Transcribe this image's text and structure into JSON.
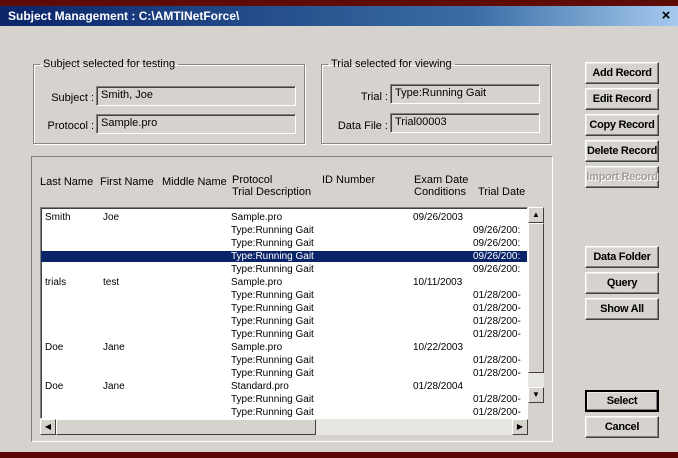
{
  "window": {
    "title": "Subject Management : C:\\AMTINetForce\\",
    "close_glyph": "×"
  },
  "subject_group": {
    "legend": "Subject selected for testing",
    "subject_label": "Subject :",
    "subject_value": "Smith, Joe",
    "protocol_label": "Protocol :",
    "protocol_value": "Sample.pro"
  },
  "trial_group": {
    "legend": "Trial selected for viewing",
    "trial_label": "Trial :",
    "trial_value": "Type:Running Gait",
    "datafile_label": "Data File :",
    "datafile_value": "Trial00003"
  },
  "list": {
    "headers": {
      "last_name": "Last Name",
      "first_name": "First Name",
      "middle_name": "Middle Name",
      "protocol": "Protocol",
      "trial_description": "Trial Description",
      "id_number": "ID Number",
      "exam_date": "Exam Date",
      "conditions": "Conditions",
      "trial_date": "Trial Date"
    },
    "rows": [
      {
        "last": "Smith",
        "first": "Joe",
        "desc": "Sample.pro",
        "exam": "09/26/2003",
        "trial": "",
        "selected": false
      },
      {
        "last": "",
        "first": "",
        "desc": "Type:Running Gait",
        "exam": "",
        "trial": "09/26/200:",
        "selected": false
      },
      {
        "last": "",
        "first": "",
        "desc": "Type:Running Gait",
        "exam": "",
        "trial": "09/26/200:",
        "selected": false
      },
      {
        "last": "",
        "first": "",
        "desc": "Type:Running Gait",
        "exam": "",
        "trial": "09/26/200:",
        "selected": true
      },
      {
        "last": "",
        "first": "",
        "desc": "Type:Running Gait",
        "exam": "",
        "trial": "09/26/200:",
        "selected": false
      },
      {
        "last": "trials",
        "first": "test",
        "desc": "Sample.pro",
        "exam": "10/11/2003",
        "trial": "",
        "selected": false
      },
      {
        "last": "",
        "first": "",
        "desc": "Type:Running Gait",
        "exam": "",
        "trial": "01/28/200-",
        "selected": false
      },
      {
        "last": "",
        "first": "",
        "desc": "Type:Running Gait",
        "exam": "",
        "trial": "01/28/200-",
        "selected": false
      },
      {
        "last": "",
        "first": "",
        "desc": "Type:Running Gait",
        "exam": "",
        "trial": "01/28/200-",
        "selected": false
      },
      {
        "last": "",
        "first": "",
        "desc": "Type:Running Gait",
        "exam": "",
        "trial": "01/28/200-",
        "selected": false
      },
      {
        "last": "Doe",
        "first": "Jane",
        "desc": "Sample.pro",
        "exam": "10/22/2003",
        "trial": "",
        "selected": false
      },
      {
        "last": "",
        "first": "",
        "desc": "Type:Running Gait",
        "exam": "",
        "trial": "01/28/200-",
        "selected": false
      },
      {
        "last": "",
        "first": "",
        "desc": "Type:Running Gait",
        "exam": "",
        "trial": "01/28/200-",
        "selected": false
      },
      {
        "last": "Doe",
        "first": "Jane",
        "desc": "Standard.pro",
        "exam": "01/28/2004",
        "trial": "",
        "selected": false
      },
      {
        "last": "",
        "first": "",
        "desc": "Type:Running Gait",
        "exam": "",
        "trial": "01/28/200-",
        "selected": false
      },
      {
        "last": "",
        "first": "",
        "desc": "Type:Running Gait",
        "exam": "",
        "trial": "01/28/200-",
        "selected": false
      }
    ]
  },
  "buttons": {
    "add_record": "Add Record",
    "edit_record": "Edit Record",
    "copy_record": "Copy Record",
    "delete_record": "Delete Record",
    "import_record": "Import Record",
    "data_folder": "Data Folder",
    "query": "Query",
    "show_all": "Show All",
    "select": "Select",
    "cancel": "Cancel"
  },
  "scroll_glyphs": {
    "up": "▲",
    "down": "▼",
    "left": "◀",
    "right": "▶"
  }
}
